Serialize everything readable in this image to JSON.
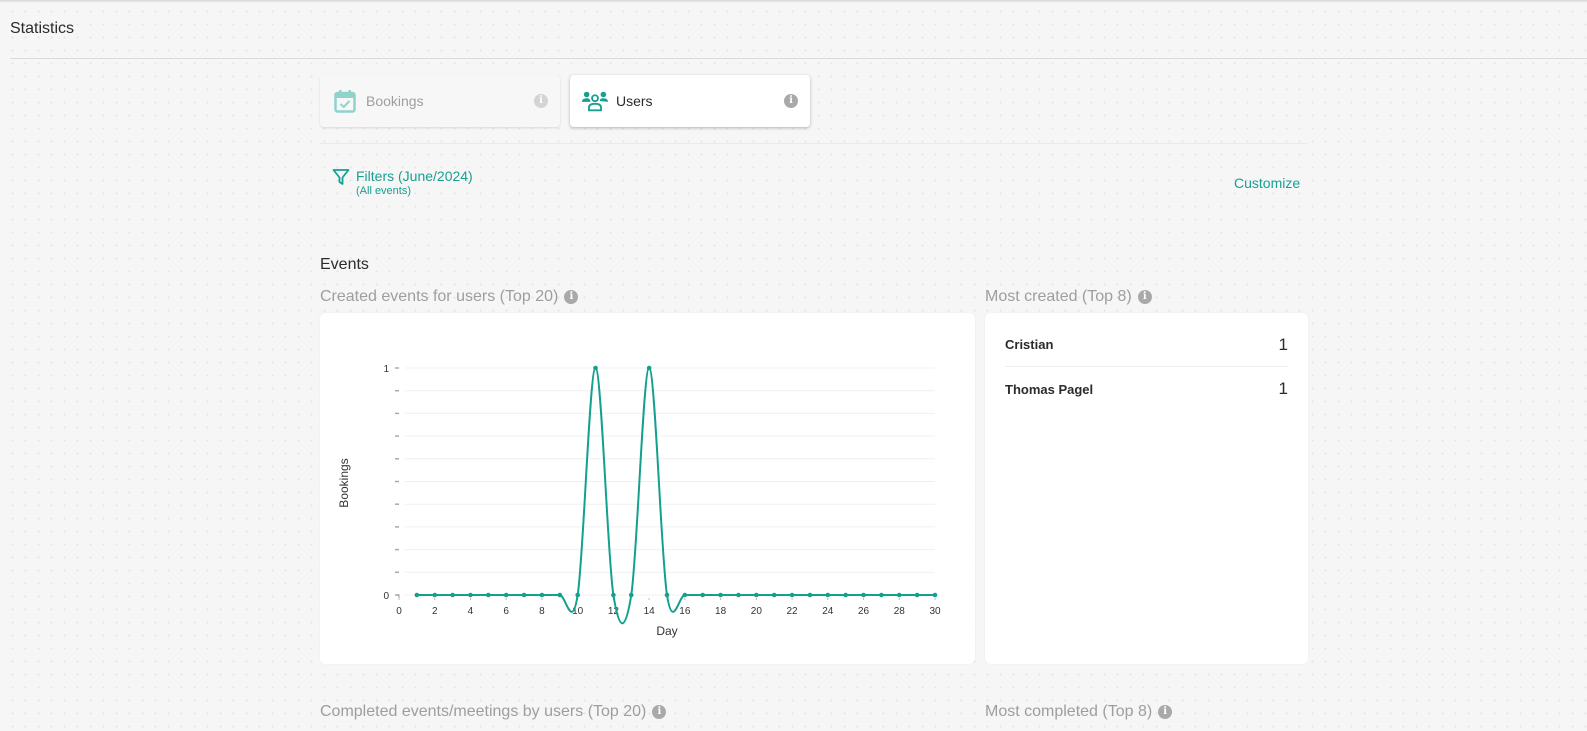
{
  "page": {
    "title": "Statistics"
  },
  "tabs": [
    {
      "label": "Bookings",
      "icon": "calendar-check-icon",
      "active": false
    },
    {
      "label": "Users",
      "icon": "users-group-icon",
      "active": true
    }
  ],
  "filters": {
    "label": "Filters (June/2024)",
    "sublabel": "(All events)",
    "icon": "filter-icon",
    "customize_label": "Customize"
  },
  "colors": {
    "accent": "#17a092",
    "line": "#14a08f"
  },
  "events": {
    "section_title": "Events",
    "created_chart_title": "Created events for users (Top 20)",
    "most_created_title": "Most created (Top 8)",
    "most_created": [
      {
        "name": "Cristian",
        "value": "1"
      },
      {
        "name": "Thomas Pagel",
        "value": "1"
      }
    ],
    "completed_chart_title": "Completed events/meetings by users (Top 20)",
    "most_completed_title": "Most completed (Top 8)"
  },
  "chart_data": {
    "type": "line",
    "title": "",
    "xlabel": "Day",
    "ylabel": "Bookings",
    "x": [
      1,
      2,
      3,
      4,
      5,
      6,
      7,
      8,
      9,
      10,
      11,
      12,
      13,
      14,
      15,
      16,
      17,
      18,
      19,
      20,
      21,
      22,
      23,
      24,
      25,
      26,
      27,
      28,
      29,
      30
    ],
    "series": [
      {
        "name": "Bookings",
        "values": [
          0,
          0,
          0,
          0,
          0,
          0,
          0,
          0,
          0,
          0,
          1,
          0,
          0,
          1,
          0,
          0,
          0,
          0,
          0,
          0,
          0,
          0,
          0,
          0,
          0,
          0,
          0,
          0,
          0,
          0
        ]
      }
    ],
    "xlim": [
      0,
      30
    ],
    "ylim": [
      0,
      1
    ],
    "xticks": [
      "0",
      "2",
      "4",
      "6",
      "8",
      "10",
      "12",
      "14",
      "16",
      "18",
      "20",
      "22",
      "24",
      "26",
      "28",
      "30"
    ],
    "yticks": [
      "0",
      "1"
    ],
    "grid": true,
    "legend": "none"
  }
}
